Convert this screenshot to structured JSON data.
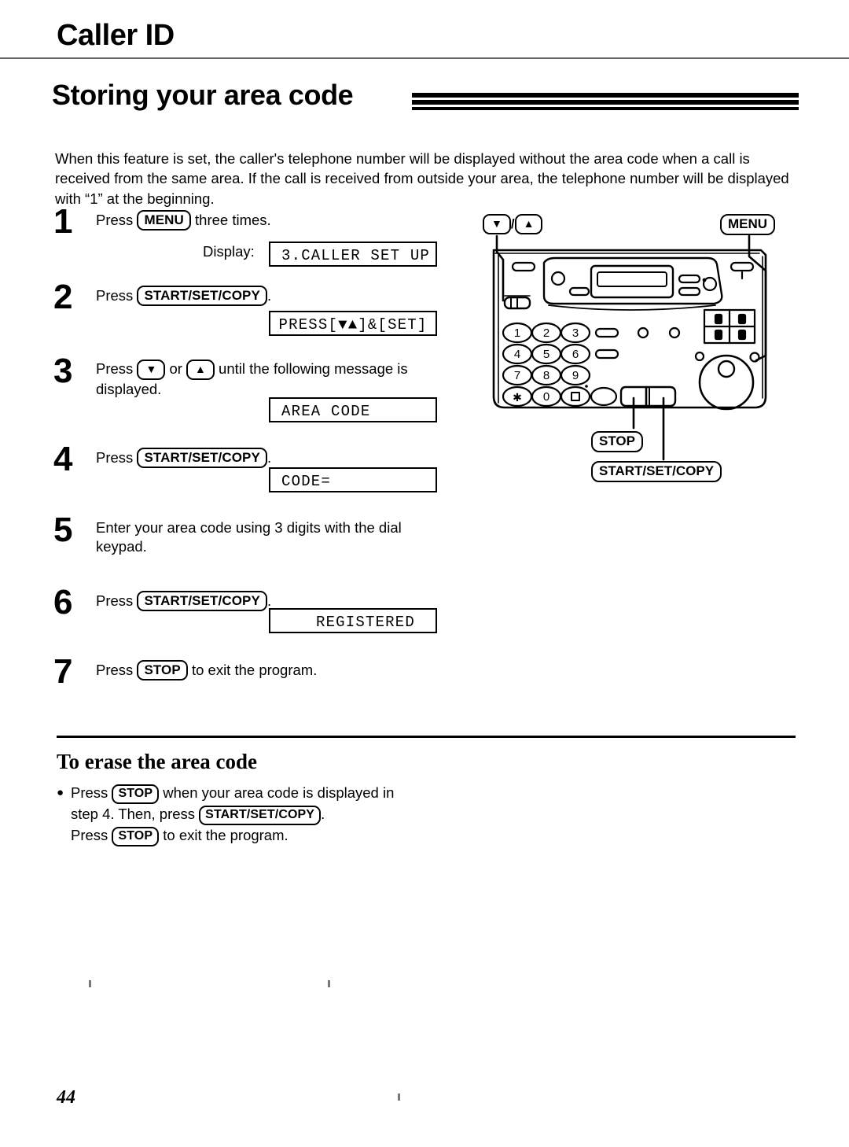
{
  "chapter": {
    "title": "Caller ID"
  },
  "section": {
    "title": "Storing your area code"
  },
  "intro": {
    "text": "When this feature is set, the caller's telephone number will be displayed without the area code when a call is received from the same area. If the call is received from outside your area, the telephone number will be displayed with “1” at the beginning."
  },
  "labels": {
    "display": "Display:",
    "press": "Press",
    "or": "or"
  },
  "keys": {
    "menu": "MENU",
    "start_set_copy": "START/SET/COPY",
    "stop": "STOP",
    "down_arrow": "▼",
    "up_arrow": "▲"
  },
  "steps": [
    {
      "num": "1",
      "text_before": "Press",
      "key": "MENU",
      "text_after": "three times.",
      "display_label": "Display:",
      "lcd": "3.CALLER SET UP"
    },
    {
      "num": "2",
      "text_before": "Press",
      "key": "START/SET/COPY",
      "text_after": ".",
      "lcd": "PRESS[▼▲]&[SET]"
    },
    {
      "num": "3",
      "text_before": "Press",
      "key_down": "▼",
      "mid": "or",
      "key_up": "▲",
      "text_after": "until the following message is",
      "text_line2": "displayed.",
      "lcd": "AREA CODE"
    },
    {
      "num": "4",
      "text_before": "Press",
      "key": "START/SET/COPY",
      "text_after": ".",
      "lcd": "CODE="
    },
    {
      "num": "5",
      "text_line1": "Enter your area code using 3 digits with the dial",
      "text_line2": "keypad."
    },
    {
      "num": "6",
      "text_before": "Press",
      "key": "START/SET/COPY",
      "text_after": ".",
      "lcd": "REGISTERED"
    },
    {
      "num": "7",
      "text_before": "Press",
      "key": "STOP",
      "text_after": "to exit the program."
    }
  ],
  "erase": {
    "title": "To erase the area code",
    "bullet": "●",
    "line1_a": "Press",
    "line1_key": "STOP",
    "line1_b": "when your area code is displayed in",
    "line2_a": "step 4. Then, press",
    "line2_key": "START/SET/COPY",
    "line2_b": ".",
    "line3_a": "Press",
    "line3_key": "STOP",
    "line3_b": "to exit the program."
  },
  "figure": {
    "name": "fax-machine-control-panel-diagram",
    "callouts": {
      "updown_down": "▼",
      "updown_sep": "/",
      "updown_up": "▲",
      "menu": "MENU",
      "stop": "STOP",
      "start": "START/SET/COPY"
    },
    "keypad": [
      "1",
      "2",
      "3",
      "4",
      "5",
      "6",
      "7",
      "8",
      "9",
      "✱",
      "0",
      "■"
    ]
  },
  "page_number": "44",
  "colors": {
    "ink": "#000000",
    "paper": "#ffffff"
  }
}
